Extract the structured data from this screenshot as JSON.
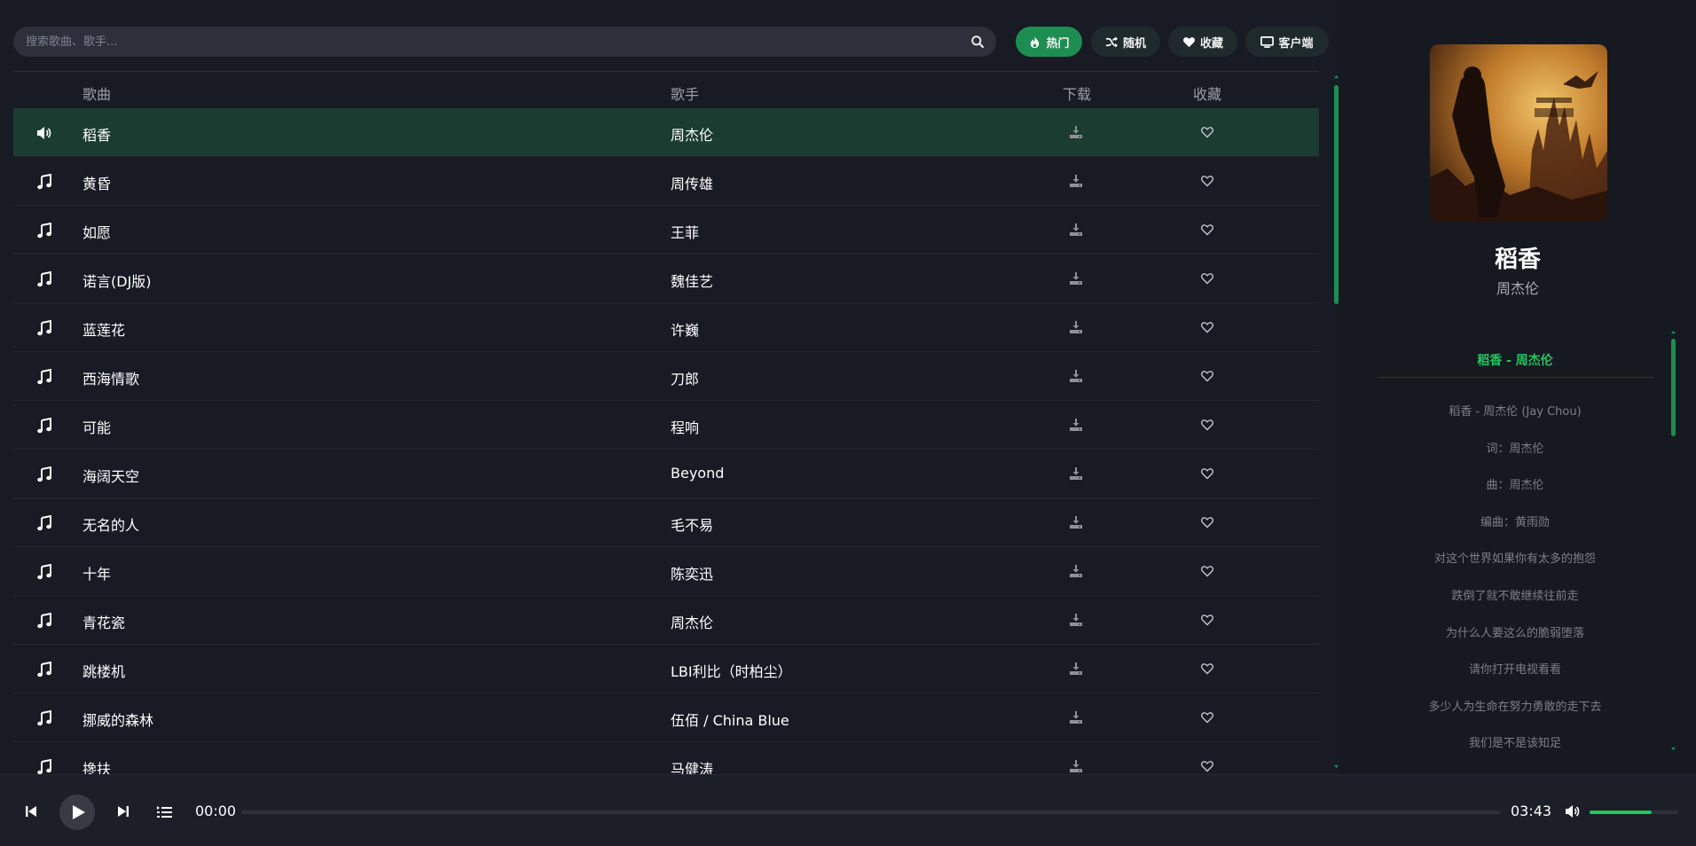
{
  "search": {
    "placeholder": "搜索歌曲、歌手..."
  },
  "nav": [
    {
      "label": "热门",
      "icon": "fire-icon",
      "active": true
    },
    {
      "label": "随机",
      "icon": "shuffle-icon",
      "active": false
    },
    {
      "label": "收藏",
      "icon": "heart-icon",
      "active": false
    },
    {
      "label": "客户端",
      "icon": "desktop-icon",
      "active": false
    }
  ],
  "table": {
    "headers": {
      "song": "歌曲",
      "artist": "歌手",
      "download": "下载",
      "favorite": "收藏"
    },
    "rows": [
      {
        "song": "稻香",
        "artist": "周杰伦",
        "playing": true
      },
      {
        "song": "黄昏",
        "artist": "周传雄"
      },
      {
        "song": "如愿",
        "artist": "王菲"
      },
      {
        "song": "诺言(DJ版)",
        "artist": "魏佳艺"
      },
      {
        "song": "蓝莲花",
        "artist": "许巍"
      },
      {
        "song": "西海情歌",
        "artist": "刀郎"
      },
      {
        "song": "可能",
        "artist": "程响"
      },
      {
        "song": "海阔天空",
        "artist": "Beyond"
      },
      {
        "song": "无名的人",
        "artist": "毛不易"
      },
      {
        "song": "十年",
        "artist": "陈奕迅"
      },
      {
        "song": "青花瓷",
        "artist": "周杰伦"
      },
      {
        "song": "跳楼机",
        "artist": "LBI利比（时柏尘）"
      },
      {
        "song": "挪威的森林",
        "artist": "伍佰 / China Blue"
      },
      {
        "song": "搀扶",
        "artist": "马健涛"
      }
    ]
  },
  "now_playing": {
    "title": "稻香",
    "artist": "周杰伦",
    "lyrics_header": "稻香 - 周杰伦",
    "lyrics": [
      "稻香 - 周杰伦 (Jay Chou)",
      "词：周杰伦",
      "曲：周杰伦",
      "编曲：黄雨勋",
      "对这个世界如果你有太多的抱怨",
      "跌倒了就不敢继续往前走",
      "为什么人要这么的脆弱堕落",
      "请你打开电视看看",
      "多少人为生命在努力勇敢的走下去",
      "我们是不是该知足"
    ]
  },
  "player": {
    "current_time": "00:00",
    "duration": "03:43",
    "progress_fraction": 0,
    "volume_fraction": 0.7
  },
  "colors": {
    "accent": "#1e8d52",
    "accent_text": "#26c45f",
    "playing_row": "#1b3c30"
  }
}
